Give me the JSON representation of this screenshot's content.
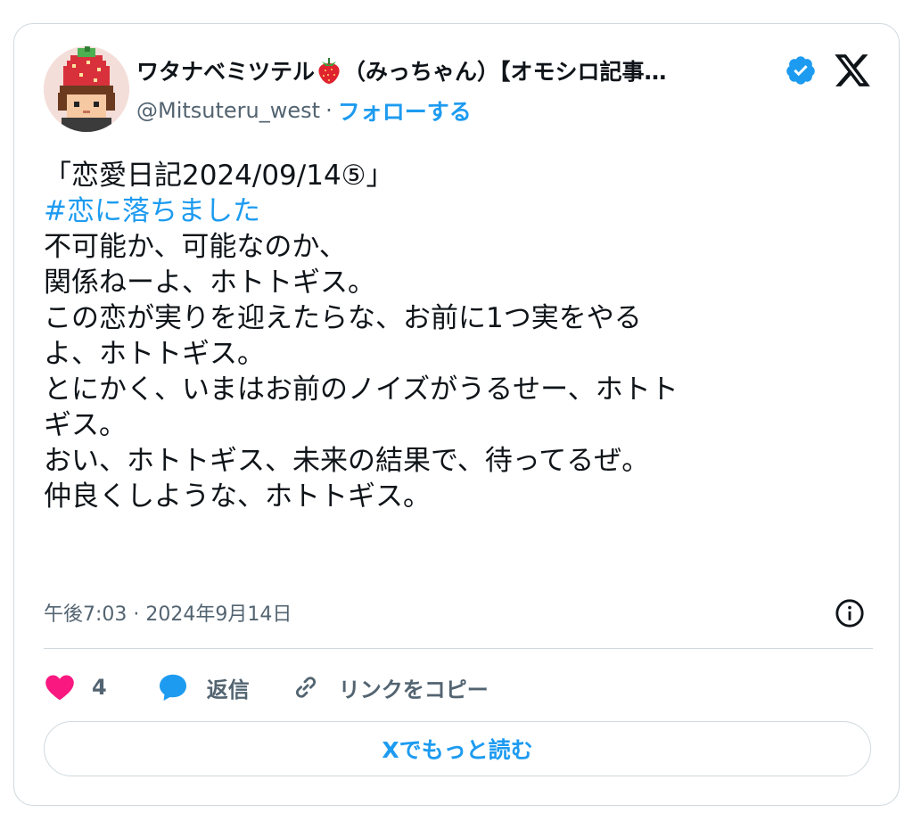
{
  "author": {
    "display_name_prefix": "ワタナベミツテル",
    "display_name_suffix": "（みっちゃん）【オモシロ記事…",
    "handle": "@Mitsuteru_west",
    "separator": "·",
    "follow_label": "フォローする",
    "avatar_icon": "pixel-strawberry-avatar",
    "name_emoji_icon": "strawberry-icon",
    "verified_icon": "verified-badge-icon"
  },
  "platform": {
    "logo_icon": "x-logo-icon"
  },
  "post": {
    "title_line": "「恋愛日記2024/09/14⑤」",
    "hashtag": "#恋に落ちました",
    "lines": [
      "不可能か、可能なのか、",
      "関係ねーよ、ホトトギス。",
      "この恋が実りを迎えたらな、お前に1つ実をやる",
      "よ、ホトトギス。",
      "とにかく、いまはお前のノイズがうるせー、ホトト",
      "ギス。",
      "おい、ホトトギス、未来の結果で、待ってるぜ。",
      "仲良くしような、ホトトギス。"
    ],
    "timestamp": "午後7:03 · 2024年9月14日"
  },
  "actions": {
    "like_count": "4",
    "reply_label": "返信",
    "copy_link_label": "リンクをコピー"
  },
  "read_more_label": "Xでもっと読む",
  "colors": {
    "accent": "#1d9bf0",
    "like": "#f91880",
    "text": "#0f1419",
    "secondary_text": "#536471",
    "border": "#cfd9de"
  }
}
